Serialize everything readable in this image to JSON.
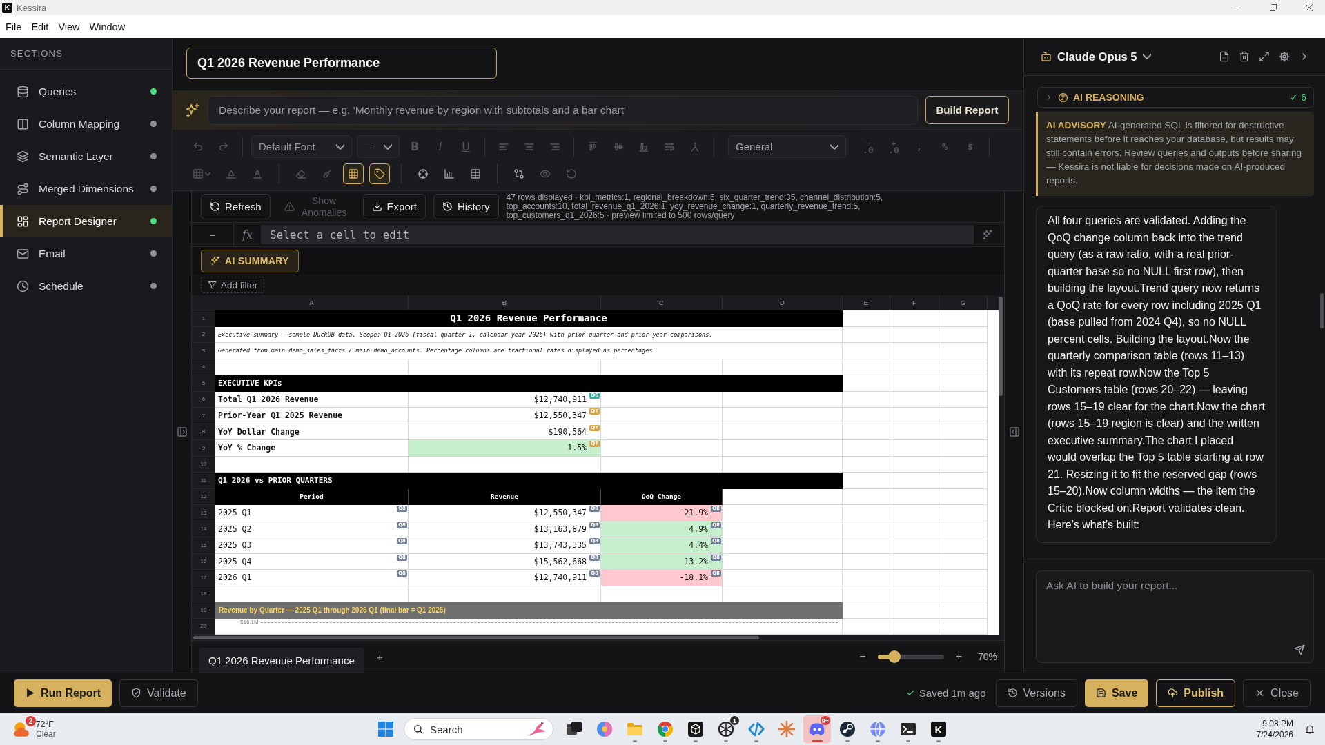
{
  "window": {
    "logo": "K",
    "title": "Kessira"
  },
  "menu": [
    {
      "label": "File"
    },
    {
      "label": "Edit"
    },
    {
      "label": "View"
    },
    {
      "label": "Window"
    }
  ],
  "sidebar": {
    "heading": "SECTIONS",
    "items": [
      {
        "label": "Queries",
        "selected": false,
        "color": "#4ade80"
      },
      {
        "label": "Column Mapping",
        "selected": false,
        "color": "#8e8e94"
      },
      {
        "label": "Semantic Layer",
        "selected": false,
        "color": "#8e8e94"
      },
      {
        "label": "Merged Dimensions",
        "selected": false,
        "color": "#8e8e94"
      },
      {
        "label": "Report Designer",
        "selected": true,
        "color": "#4ade80"
      },
      {
        "label": "Email",
        "selected": false,
        "color": "#8e8e94"
      },
      {
        "label": "Schedule",
        "selected": false,
        "color": "#8e8e94"
      }
    ]
  },
  "report_title": {
    "value": "Q1 2026 Revenue Performance"
  },
  "prompt": {
    "placeholder": "Describe your report — e.g. 'Monthly revenue by region with subtotals and a bar chart'",
    "button": "Build Report"
  },
  "toolbar": {
    "history": [
      {
        "disabled": true
      },
      {
        "disabled": true
      }
    ],
    "font": {
      "value": "Default Font",
      "disabled": true
    },
    "font_size": {
      "value": "—",
      "disabled": true
    },
    "text_style": [
      {
        "label": "B",
        "disabled": true
      },
      {
        "label": "I",
        "disabled": true
      },
      {
        "label": "U",
        "disabled": true
      }
    ],
    "align": [
      {
        "disabled": true
      },
      {
        "disabled": true
      },
      {
        "disabled": true
      }
    ],
    "layout": [
      {
        "disabled": true
      },
      {
        "disabled": true
      },
      {
        "disabled": true
      },
      {
        "disabled": true
      },
      {
        "disabled": true
      }
    ],
    "number_format": {
      "value": "General",
      "disabled": false
    },
    "number_buttons": [
      {
        "mark": "−",
        "label": ".0",
        "disabled": true
      },
      {
        "mark": "+",
        "label": ".0",
        "disabled": true
      },
      {
        "label": ",",
        "disabled": true
      },
      {
        "label": "%",
        "disabled": true
      },
      {
        "label": "$",
        "disabled": true
      }
    ],
    "cell_format": [
      {
        "disabled": true
      },
      {
        "disabled": true
      },
      {
        "disabled": true
      }
    ],
    "tools": [
      {
        "on": false,
        "disabled": true
      },
      {
        "on": false,
        "disabled": true
      },
      {
        "on": true,
        "disabled": false
      },
      {
        "on": true,
        "disabled": false
      }
    ],
    "insert": [
      {
        "disabled": false
      },
      {
        "disabled": false
      },
      {
        "disabled": false
      }
    ],
    "extras": [
      {
        "disabled": false
      },
      {
        "disabled": true
      },
      {
        "disabled": true
      }
    ]
  },
  "actions": {
    "buttons": [
      {
        "label": "Refresh",
        "disabled": false
      },
      {
        "label": "Show Anomalies",
        "disabled": true
      },
      {
        "label": "Export",
        "disabled": false
      },
      {
        "label": "History",
        "disabled": false
      }
    ],
    "info": "47 rows displayed · kpi_metrics:1, regional_breakdown:5, six_quarter_trend:35, channel_distribution:5, top_accounts:10, total_revenue_q1_2026:1, yoy_revenue_change:1, quarterly_revenue_trend:5, top_customers_q1_2026:5 · preview limited to 500 rows/query"
  },
  "formula_bar": {
    "cell": "–",
    "fx": "fx",
    "placeholder": "Select a cell to edit"
  },
  "ai_summary": {
    "label": "AI SUMMARY"
  },
  "filter": {
    "label": "Add filter"
  },
  "sheet": {
    "columns": [
      "A",
      "B",
      "C",
      "D",
      "E",
      "F",
      "G"
    ],
    "rows": [
      {
        "number": "1",
        "kind": "title",
        "text": "Q1 2026 Revenue Performance"
      },
      {
        "number": "2",
        "kind": "note",
        "text": "Executive summary — sample DuckDB data. Scope: Q1 2026 (fiscal quarter 1, calendar year 2026) with prior-quarter and prior-year comparisons."
      },
      {
        "number": "3",
        "kind": "note",
        "text": "Generated from main.demo_sales_facts / main.demo_accounts. Percentage columns are fractional rates displayed as percentages."
      },
      {
        "number": "4",
        "kind": "blank"
      },
      {
        "number": "5",
        "kind": "section",
        "text": "EXECUTIVE KPIs"
      },
      {
        "number": "6",
        "kind": "kpi",
        "cells": [
          {
            "text": "Total Q1 2026 Revenue"
          },
          {
            "text": "$12,740,911",
            "tag": {
              "text": "Q6",
              "color": "#25b59f"
            }
          }
        ]
      },
      {
        "number": "7",
        "kind": "kpi",
        "cells": [
          {
            "text": "Prior-Year Q1 2025 Revenue"
          },
          {
            "text": "$12,550,347",
            "tag": {
              "text": "Q7",
              "color": "#d8a24a"
            }
          }
        ]
      },
      {
        "number": "8",
        "kind": "kpi",
        "cells": [
          {
            "text": "YoY Dollar Change"
          },
          {
            "text": "$190,564",
            "tag": {
              "text": "Q7",
              "color": "#d8a24a"
            }
          }
        ]
      },
      {
        "number": "9",
        "kind": "kpi",
        "cells": [
          {
            "text": "YoY % Change"
          },
          {
            "text": "1.5%",
            "tag": {
              "text": "Q7",
              "color": "#d8a24a"
            },
            "color": "#c6efce"
          }
        ]
      },
      {
        "number": "10",
        "kind": "blank"
      },
      {
        "number": "11",
        "kind": "section",
        "text": "Q1 2026 vs PRIOR QUARTERS"
      },
      {
        "number": "12",
        "kind": "header",
        "cells": [
          {
            "text": "Period"
          },
          {
            "text": "Revenue"
          },
          {
            "text": "QoQ Change"
          }
        ]
      },
      {
        "number": "13",
        "kind": "data",
        "cells": [
          {
            "text": "2025 Q1",
            "tag": {
              "text": "Q8",
              "color": "#718096"
            }
          },
          {
            "text": "$12,550,347",
            "tag": {
              "text": "Q8",
              "color": "#718096"
            }
          },
          {
            "text": "-21.9%",
            "tag": {
              "text": "Q8",
              "color": "#718096"
            },
            "color": "#ffc7ce"
          }
        ]
      },
      {
        "number": "14",
        "kind": "data",
        "cells": [
          {
            "text": "2025 Q2",
            "tag": {
              "text": "Q8",
              "color": "#718096"
            }
          },
          {
            "text": "$13,163,879",
            "tag": {
              "text": "Q8",
              "color": "#718096"
            }
          },
          {
            "text": "4.9%",
            "tag": {
              "text": "Q8",
              "color": "#718096"
            },
            "color": "#c6efce"
          }
        ]
      },
      {
        "number": "15",
        "kind": "data",
        "cells": [
          {
            "text": "2025 Q3",
            "tag": {
              "text": "Q8",
              "color": "#718096"
            }
          },
          {
            "text": "$13,743,335",
            "tag": {
              "text": "Q8",
              "color": "#718096"
            }
          },
          {
            "text": "4.4%",
            "tag": {
              "text": "Q8",
              "color": "#718096"
            },
            "color": "#c6efce"
          }
        ]
      },
      {
        "number": "16",
        "kind": "data",
        "cells": [
          {
            "text": "2025 Q4",
            "tag": {
              "text": "Q8",
              "color": "#718096"
            }
          },
          {
            "text": "$15,562,668",
            "tag": {
              "text": "Q8",
              "color": "#718096"
            }
          },
          {
            "text": "13.2%",
            "tag": {
              "text": "Q8",
              "color": "#718096"
            },
            "color": "#c6efce"
          }
        ]
      },
      {
        "number": "17",
        "kind": "data",
        "cells": [
          {
            "text": "2026 Q1",
            "tag": {
              "text": "Q8",
              "color": "#718096"
            }
          },
          {
            "text": "$12,740,911",
            "tag": {
              "text": "Q8",
              "color": "#718096"
            }
          },
          {
            "text": "-18.1%",
            "tag": {
              "text": "Q8",
              "color": "#718096"
            },
            "color": "#ffc7ce"
          }
        ]
      },
      {
        "number": "18",
        "kind": "blank"
      },
      {
        "number": "19",
        "kind": "banner",
        "text": "Revenue by Quarter — 2025 Q1 through 2026 Q1 (final bar = Q1 2026)"
      },
      {
        "number": "20",
        "kind": "chart",
        "text": "$16.1M"
      }
    ]
  },
  "sheet_tabs": {
    "tabs": [
      {
        "label": "Q1 2026 Revenue Performance",
        "selected": true
      }
    ],
    "add": "+"
  },
  "zoom": {
    "minus": "−",
    "plus": "+",
    "level": 0.25,
    "reading": "70%"
  },
  "assistant": {
    "model": "Claude Opus 5",
    "reasoning": {
      "label": "AI REASONING",
      "expanded": false,
      "count": "✓ 6"
    },
    "advisory": {
      "text": "**AI ADVISORY** AI-generated SQL is filtered for destructive statements before it reaches your database, but results may still contain errors. Review queries and outputs before sharing — Kessira is not liable for decisions made on AI-produced reports."
    },
    "messages": [
      {
        "text": "All four queries are validated. Adding the QoQ change column back into the trend query (as a raw ratio, with a real prior-quarter base so no NULL first row), then building the layout.Trend query now returns a QoQ rate for every row including 2025 Q1 (base pulled from 2024 Q4), so no NULL percent cells. Building the layout.Now the quarterly comparison table (rows 11–13) with its repeat row.Now the Top 5 Customers table (rows 20–22) — leaving rows 15–19 clear for the chart.Now the chart (rows 15–19 region is clear) and the written executive summary.The chart I placed would overlap the Top 5 table starting at row 21. Resizing it to fit the reserved gap (rows 15–20).Now column widths — the item the Critic blocked on.Report validates clean. Here's what's built:"
      }
    ],
    "input": {
      "placeholder": "Ask AI to build your report..."
    }
  },
  "footer": {
    "left": [
      {
        "label": "Run Report",
        "kind": "primary"
      },
      {
        "label": "Validate",
        "kind": "outline"
      }
    ],
    "status": "Saved 1m ago",
    "right": [
      {
        "label": "Versions",
        "kind": "outline"
      },
      {
        "label": "Save",
        "kind": "primary"
      },
      {
        "label": "Publish",
        "kind": "accent"
      },
      {
        "label": "Close",
        "kind": "outline"
      }
    ]
  },
  "taskbar": {
    "weather": {
      "badge": "2",
      "temp": "72°F",
      "condition": "Clear"
    },
    "search": {
      "label": "Search"
    },
    "apps": [
      {
        "selected": false,
        "running": false
      },
      {
        "selected": false,
        "running": false
      },
      {
        "selected": false,
        "running": true
      },
      {
        "selected": false,
        "running": true
      },
      {
        "selected": false,
        "running": true
      },
      {
        "selected": false,
        "running": true,
        "badge": "1"
      },
      {
        "selected": false,
        "running": true
      },
      {
        "selected": false,
        "running": false
      },
      {
        "selected": true,
        "running": true,
        "badge": "9+"
      },
      {
        "selected": false,
        "running": true
      },
      {
        "selected": false,
        "running": true
      },
      {
        "selected": false,
        "running": true
      },
      {
        "selected": false,
        "running": true,
        "label": "K"
      }
    ],
    "clock": {
      "time": "9:08 PM",
      "date": "7/24/2026"
    }
  }
}
